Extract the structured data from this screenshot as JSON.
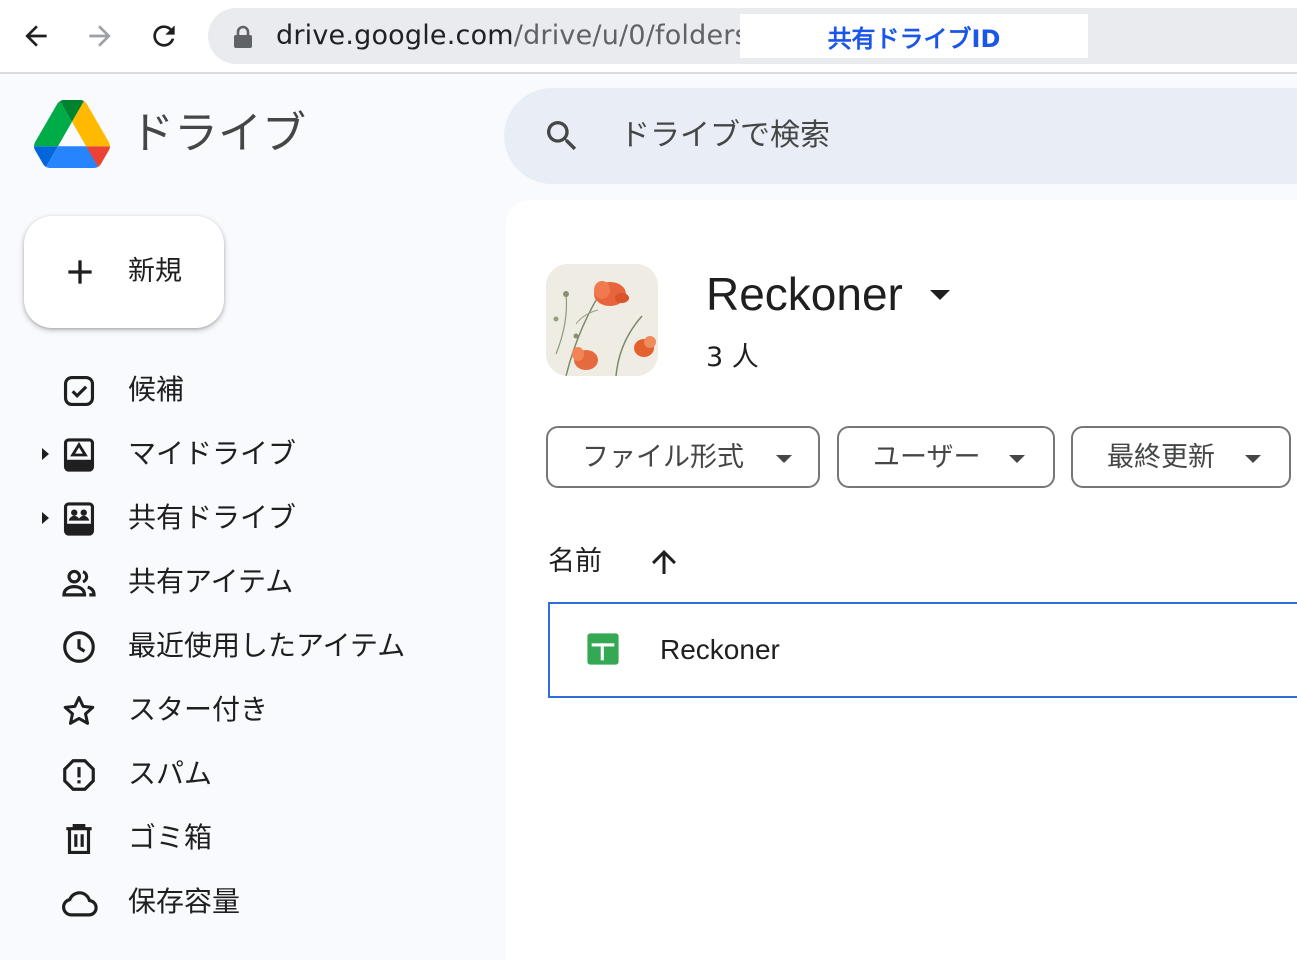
{
  "browser": {
    "url_host": "drive.google.com",
    "url_path": "/drive/u/0/folders/",
    "highlight_label": "共有ドライブID"
  },
  "app": {
    "title": "ドライブ"
  },
  "search": {
    "placeholder": "ドライブで検索"
  },
  "new_button": {
    "label": "新規"
  },
  "sidebar": {
    "items": [
      {
        "label": "候補",
        "icon": "check-box-icon",
        "expandable": false
      },
      {
        "label": "マイドライブ",
        "icon": "my-drive-icon",
        "expandable": true
      },
      {
        "label": "共有ドライブ",
        "icon": "shared-drives-icon",
        "expandable": true
      },
      {
        "label": "共有アイテム",
        "icon": "people-icon",
        "expandable": false
      },
      {
        "label": "最近使用したアイテム",
        "icon": "clock-icon",
        "expandable": false
      },
      {
        "label": "スター付き",
        "icon": "star-icon",
        "expandable": false
      },
      {
        "label": "スパム",
        "icon": "spam-icon",
        "expandable": false
      },
      {
        "label": "ゴミ箱",
        "icon": "trash-icon",
        "expandable": false
      },
      {
        "label": "保存容量",
        "icon": "cloud-icon",
        "expandable": false
      }
    ]
  },
  "shared_drive": {
    "name": "Reckoner",
    "members": "3 人"
  },
  "filters": [
    {
      "label": "ファイル形式"
    },
    {
      "label": "ユーザー"
    },
    {
      "label": "最終更新"
    }
  ],
  "file_list": {
    "column_name": "名前",
    "sort": "ascending",
    "rows": [
      {
        "name": "Reckoner",
        "type": "spreadsheet",
        "selected": true
      }
    ]
  },
  "colors": {
    "accent": "#2f6ed8",
    "highlight_text": "#1a56e8",
    "sheets_green": "#34a853"
  }
}
